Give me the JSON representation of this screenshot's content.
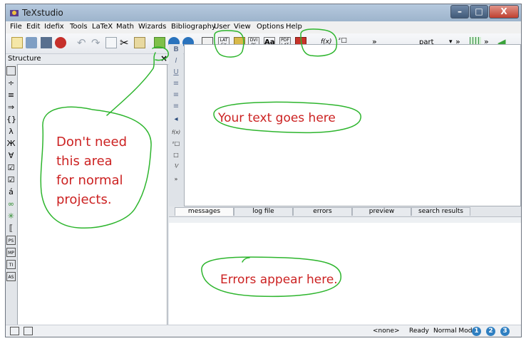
{
  "window": {
    "title": "TeXstudio",
    "minimize": "–",
    "maximize": "□",
    "close": "X"
  },
  "menu": [
    "File",
    "Edit",
    "Idefix",
    "Tools",
    "LaTeX",
    "Math",
    "Wizards",
    "Bibliography",
    "User",
    "View",
    "Options",
    "Help"
  ],
  "toolbar": {
    "fx_label": "f(x)",
    "more1": "»",
    "more2": "»",
    "more3": "»",
    "structure_select": "part",
    "latex_label": "LAT EX",
    "dvips_label": "DVI PS",
    "aa_label": "Aa",
    "pdflatex_label": "PDF LAT"
  },
  "structure_panel": {
    "title": "Structure",
    "close": "×"
  },
  "tabs": [
    "messages",
    "log file",
    "errors",
    "preview",
    "search results"
  ],
  "active_tab": "messages",
  "status": {
    "none": "<none>",
    "ready": "Ready",
    "mode": "Normal Mode",
    "c1": "1",
    "c2": "2",
    "c3": "3"
  },
  "annotations": {
    "left": [
      "Don't need",
      "this area",
      "for normal",
      "projects."
    ],
    "editor": "Your text goes here",
    "errors": "Errors appear here."
  },
  "colors": {
    "annotation_text": "#cc2222",
    "annotation_stroke": "#2db52d",
    "title_bar": "#9db4cc"
  }
}
